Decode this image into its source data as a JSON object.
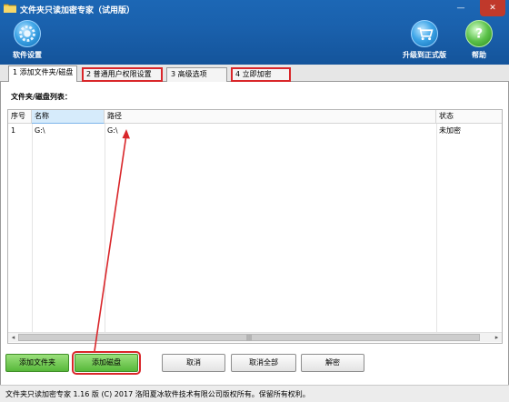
{
  "window": {
    "title": "文件夹只读加密专家（试用版）",
    "minimize_glyph": "—",
    "close_glyph": "✕"
  },
  "toolbar": {
    "settings_label": "软件设置",
    "settings_icon": "gear-icon",
    "upgrade_label": "升级到正式版",
    "upgrade_icon": "cart-icon",
    "help_label": "帮助",
    "help_icon": "help-icon"
  },
  "tabs": [
    {
      "label": "1 添加文件夹/磁盘",
      "active": true
    },
    {
      "label": "2 普通用户权限设置",
      "active": false
    },
    {
      "label": "3 高级选项",
      "active": false
    },
    {
      "label": "4 立即加密",
      "active": false
    }
  ],
  "list": {
    "caption": "文件夹/磁盘列表：",
    "columns": [
      "序号",
      "名称",
      "路径",
      "状态"
    ],
    "rows": [
      {
        "seq": "1",
        "name": "G:\\",
        "path": "G:\\",
        "status": "未加密"
      }
    ],
    "hscroll_left": "◂",
    "hscroll_right": "▸",
    "hscroll_grip": "|||"
  },
  "buttons": {
    "add_folder": "添加文件夹",
    "add_disk": "添加磁盘",
    "cancel": "取消",
    "cancel_all": "取消全部",
    "decrypt": "解密"
  },
  "status_bar": {
    "text": "文件夹只读加密专家 1.16 版 (C) 2017 洛阳夏冰软件技术有限公司版权所有。保留所有权利。"
  },
  "colors": {
    "header_blue": "#1a61ad",
    "annotation_red": "#d9262a",
    "button_green": "#57b83a"
  }
}
